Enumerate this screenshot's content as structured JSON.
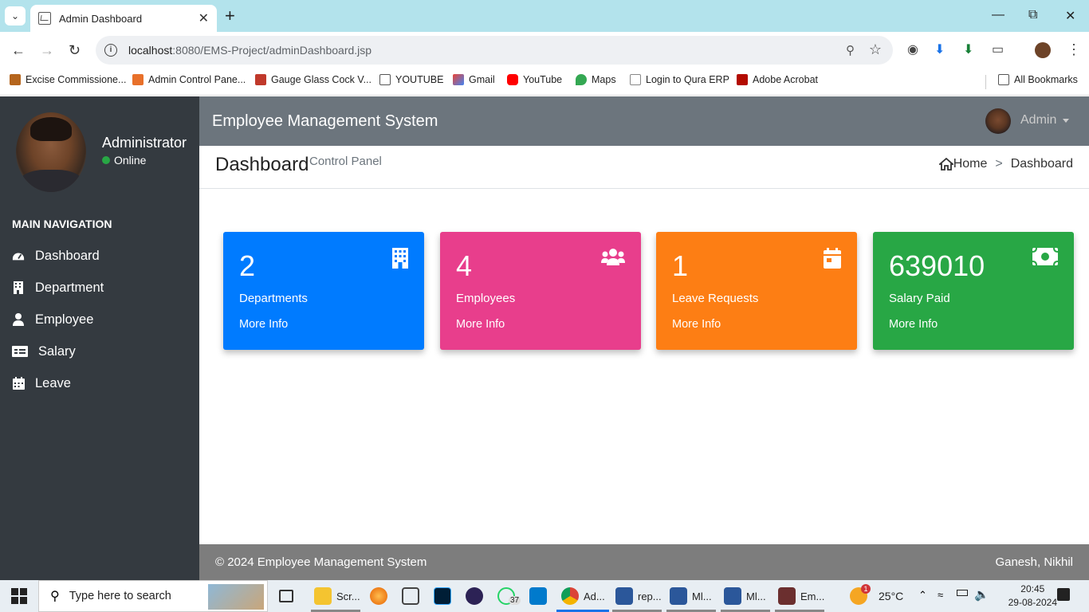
{
  "browser": {
    "tab_title": "Admin Dashboard",
    "url_host": "localhost",
    "url_path": ":8080/EMS-Project/adminDashboard.jsp",
    "bookmarks": [
      {
        "label": "Excise Commissione..."
      },
      {
        "label": "Admin Control Pane..."
      },
      {
        "label": "Gauge Glass Cock V..."
      },
      {
        "label": "YOUTUBE"
      },
      {
        "label": "Gmail"
      },
      {
        "label": "YouTube"
      },
      {
        "label": "Maps"
      },
      {
        "label": "Login to Qura ERP"
      },
      {
        "label": "Adobe Acrobat"
      }
    ],
    "all_bookmarks": "All Bookmarks"
  },
  "sidebar": {
    "user_name": "Administrator",
    "user_status": "Online",
    "nav_header": "MAIN NAVIGATION",
    "items": [
      {
        "label": "Dashboard",
        "icon": "dashboard-icon"
      },
      {
        "label": "Department",
        "icon": "building-icon"
      },
      {
        "label": "Employee",
        "icon": "user-icon"
      },
      {
        "label": "Salary",
        "icon": "salary-card-icon"
      },
      {
        "label": "Leave",
        "icon": "calendar-icon"
      }
    ]
  },
  "header": {
    "app_title": "Employee Management System",
    "admin_label": "Admin"
  },
  "content": {
    "title": "Dashboard",
    "subtitle": "Control Panel",
    "breadcrumb_home": "Home",
    "breadcrumb_sep": ">",
    "breadcrumb_current": "Dashboard"
  },
  "cards": [
    {
      "number": "2",
      "label": "Departments",
      "more": "More Info",
      "color": "#007bff",
      "icon": "building-icon"
    },
    {
      "number": "4",
      "label": "Employees",
      "more": "More Info",
      "color": "#e83e8c",
      "icon": "users-icon"
    },
    {
      "number": "1",
      "label": "Leave Requests",
      "more": "More Info",
      "color": "#fd7e14",
      "icon": "calendar-icon"
    },
    {
      "number": "639010",
      "label": "Salary Paid",
      "more": "More Info",
      "color": "#28a745",
      "icon": "money-icon"
    }
  ],
  "footer": {
    "copyright": "© 2024 Employee Management System",
    "authors": "Ganesh, Nikhil"
  },
  "taskbar": {
    "search_placeholder": "Type here to search",
    "apps": [
      {
        "label": "Scr..."
      },
      {
        "label": "Ad..."
      },
      {
        "label": "rep..."
      },
      {
        "label": "Ml..."
      },
      {
        "label": "Ml..."
      },
      {
        "label": "Em..."
      }
    ],
    "whatsapp_badge": "37",
    "weather_badge": "1",
    "weather": "25°C",
    "time": "20:45",
    "date": "29-08-2024"
  }
}
